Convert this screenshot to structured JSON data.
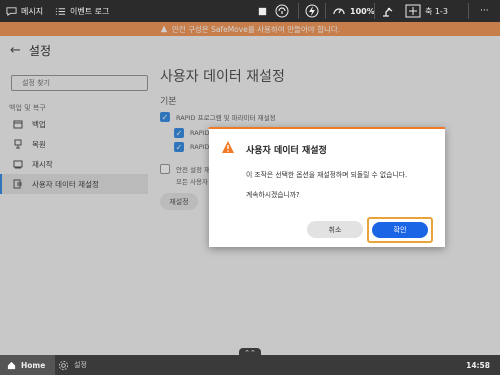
{
  "topbar": {
    "messages_label": "메시지",
    "event_log_label": "이벤트 로그",
    "speed_label": "100%",
    "task_label": "축 1-3",
    "more_label": "···"
  },
  "banner": {
    "text": "안전 구성은 SafeMove를 사용하여 만들어야 합니다."
  },
  "header": {
    "title": "설정"
  },
  "sidebar": {
    "search_placeholder": "설정 찾기",
    "section_label": "백업 및 복구",
    "items": [
      {
        "label": "백업"
      },
      {
        "label": "복원"
      },
      {
        "label": "재시작"
      },
      {
        "label": "사용자 데이터 재설정"
      }
    ]
  },
  "main": {
    "title": "사용자 데이터 재설정",
    "subtitle": "기본",
    "option_rapid": "RAPID 프로그램 및 파라미터 재설정",
    "option_sub1": "RAPID",
    "option_sub2": "RAPID",
    "option_safety_1": "안전 설정 재",
    "option_safety_2": "모든 사용자",
    "reset_label": "재설정"
  },
  "dialog": {
    "title": "사용자 데이터 재설정",
    "message": "이 조작은 선택한 옵션을 재설정하며 되돌릴 수 없습니다.",
    "question": "계속하시겠습니까?",
    "cancel_label": "취소",
    "ok_label": "확인"
  },
  "bottombar": {
    "home_label": "Home",
    "settings_label": "설정",
    "time": "14:58",
    "handle_glyph": "⌃⌃"
  },
  "colors": {
    "accent": "#3b8fe6",
    "warning": "#f27a26",
    "banner": "#f39a5c",
    "ok_button": "#1a64e6"
  }
}
